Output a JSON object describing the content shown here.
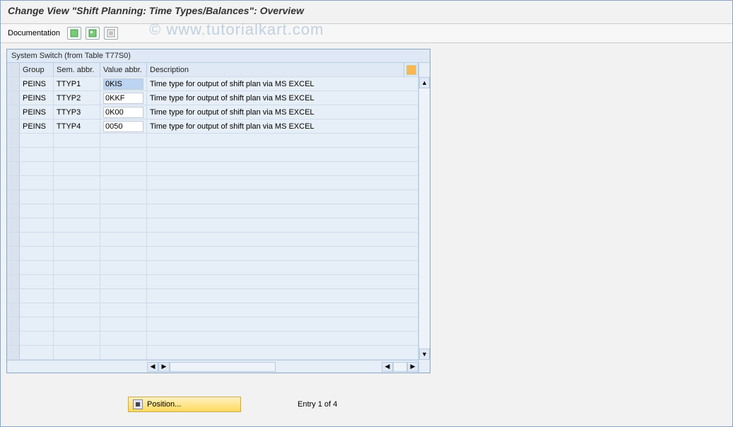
{
  "title": "Change View \"Shift Planning: Time Types/Balances\": Overview",
  "toolbar": {
    "documentation": "Documentation"
  },
  "watermark": "© www.tutorialkart.com",
  "panel": {
    "title": "System Switch (from Table T77S0)",
    "columns": {
      "group": "Group",
      "sem": "Sem. abbr.",
      "val": "Value abbr.",
      "desc": "Description"
    },
    "rows": [
      {
        "group": "PEINS",
        "sem": "TTYP1",
        "val": "0KIS",
        "desc": "Time type for output of shift plan via MS EXCEL",
        "selected": true
      },
      {
        "group": "PEINS",
        "sem": "TTYP2",
        "val": "0KKF",
        "desc": "Time type for output of shift plan via MS EXCEL"
      },
      {
        "group": "PEINS",
        "sem": "TTYP3",
        "val": "0K00",
        "desc": "Time type for output of shift plan via MS EXCEL"
      },
      {
        "group": "PEINS",
        "sem": "TTYP4",
        "val": "0050",
        "desc": "Time type for output of shift plan via MS EXCEL"
      }
    ]
  },
  "footer": {
    "position_label": "Position...",
    "entry_label": "Entry 1 of 4"
  }
}
